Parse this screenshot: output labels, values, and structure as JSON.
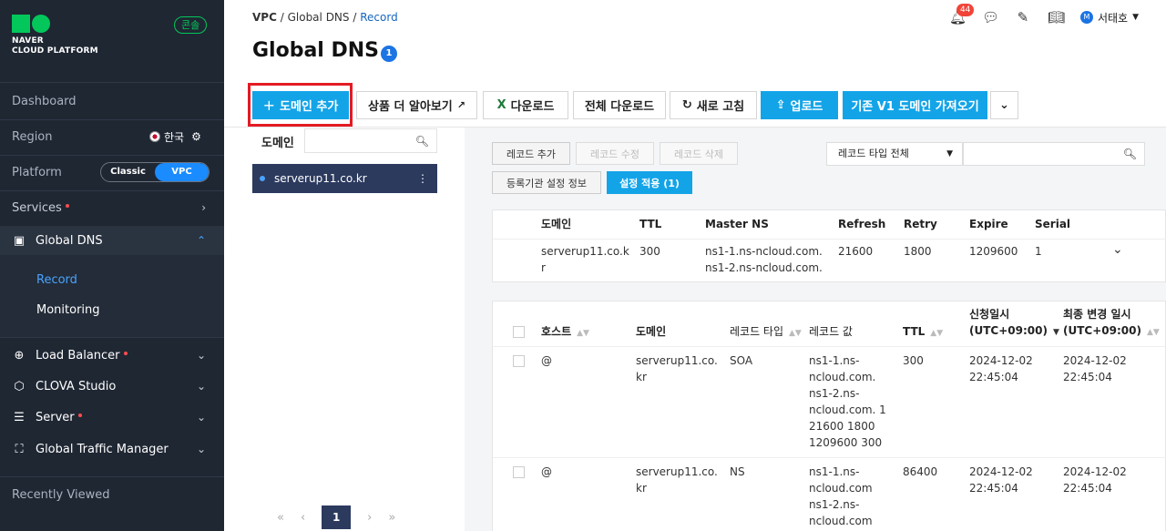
{
  "logo": {
    "line1": "NAVER",
    "line2": "CLOUD PLATFORM",
    "console": "콘솔"
  },
  "sidebar": {
    "dashboard": "Dashboard",
    "region": "Region",
    "region_value": "한국",
    "platform": "Platform",
    "platform_options": [
      "Classic",
      "VPC"
    ],
    "services": "Services",
    "global_dns": "Global DNS",
    "record": "Record",
    "monitoring": "Monitoring",
    "load_balancer": "Load Balancer",
    "clova": "CLOVA Studio",
    "server": "Server",
    "gtm": "Global Traffic Manager",
    "recently": "Recently Viewed"
  },
  "header": {
    "breadcrumb": [
      "VPC",
      "/",
      "Global DNS",
      "/",
      "Record"
    ],
    "title": "Global DNS",
    "title_badge": "1",
    "notifications": "44",
    "user": "서태호",
    "user_initial": "M"
  },
  "actions": {
    "add_domain": "도메인 추가",
    "learn_more": "상품 더 알아보기",
    "download": "다운로드",
    "download_all": "전체 다운로드",
    "refresh": "새로 고침",
    "upload": "업로드",
    "import_v1": "기존 V1 도메인 가져오기"
  },
  "left": {
    "label": "도메인",
    "domain": "serverup11.co.kr",
    "page": "1"
  },
  "right": {
    "add_record": "레코드 추가",
    "edit_record": "레코드 수정",
    "delete_record": "레코드 삭제",
    "registrar": "등록기관 설정 정보",
    "apply": "설정 적용 (1)",
    "filter": "레코드 타입 전체"
  },
  "soa": {
    "headers": [
      "도메인",
      "TTL",
      "Master NS",
      "Refresh",
      "Retry",
      "Expire",
      "Serial"
    ],
    "domain_l1": "serverup11.co.k",
    "domain_l2": "r",
    "ttl": "300",
    "ns1": "ns1-1.ns-ncloud.com.",
    "ns2": "ns1-2.ns-ncloud.com.",
    "refresh": "21600",
    "retry": "1800",
    "expire": "1209600",
    "serial": "1"
  },
  "records": {
    "headers": {
      "host": "호스트",
      "domain": "도메인",
      "type": "레코드 타입",
      "value": "레코드 값",
      "ttl": "TTL",
      "created_l1": "신청일시",
      "created_l2": "(UTC+09:00)",
      "modified_l1": "최종 변경 일시",
      "modified_l2": "(UTC+09:00)"
    },
    "rows": [
      {
        "host": "@",
        "domain_l1": "serverup11.co.",
        "domain_l2": "kr",
        "type": "SOA",
        "value": [
          "ns1-1.ns-",
          "ncloud.com.",
          "ns1-2.ns-",
          "ncloud.com. 1",
          "21600 1800",
          "1209600 300"
        ],
        "ttl": "300",
        "c_date": "2024-12-02",
        "c_time": "22:45:04",
        "m_date": "2024-12-02",
        "m_time": "22:45:04"
      },
      {
        "host": "@",
        "domain_l1": "serverup11.co.",
        "domain_l2": "kr",
        "type": "NS",
        "value": [
          "ns1-1.ns-",
          "ncloud.com",
          "ns1-2.ns-",
          "ncloud.com"
        ],
        "ttl": "86400",
        "c_date": "2024-12-02",
        "c_time": "22:45:04",
        "m_date": "2024-12-02",
        "m_time": "22:45:04"
      }
    ]
  }
}
